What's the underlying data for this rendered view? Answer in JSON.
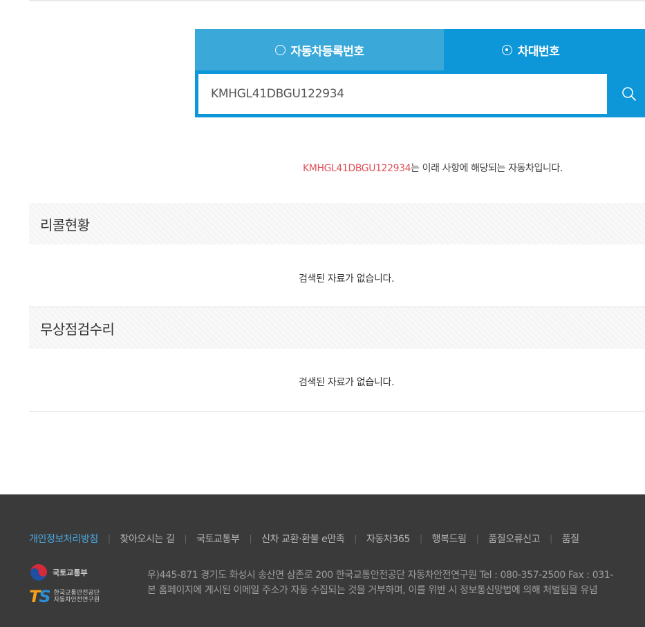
{
  "search": {
    "tab_registration": "자동차등록번호",
    "tab_vin": "차대번호",
    "selected_tab": "vin",
    "input_value": "KMHGL41DBGU122934"
  },
  "result": {
    "vin": "KMHGL41DBGU122934",
    "message_suffix": "는 이래 사항에 해당되는 자동차입니다."
  },
  "sections": {
    "recall": {
      "title": "리콜현황",
      "empty": "검색된 자료가 없습니다."
    },
    "free_repair": {
      "title": "무상점검수리",
      "empty": "검색된 자료가 없습니다."
    }
  },
  "footer": {
    "links": [
      "개인정보처리방침",
      "찾아오시는 길",
      "국토교통부",
      "신차 교환·환불 e만족",
      "자동차365",
      "행복드림",
      "품질오류신고",
      "품질"
    ],
    "logo_molit": "국토교통부",
    "logo_ts_line1": "한국교통안전공단",
    "logo_ts_line2": "자동차안전연구원",
    "address": "우)445-871 경기도 화성시 송산면 삼존로 200 한국교통안전공단 자동차안전연구원 Tel : 080-357-2500 Fax : 031-",
    "notice": "본 홈페이지에 게시된 이메일 주소가 자동 수집되는 것을 거부하며, 이를 위반 시 정보통신망법에 의해 처벌됨을 유념"
  },
  "colors": {
    "accent": "#0d96d8",
    "tab_inactive": "#3aa8d8",
    "vin_highlight": "#e0525a",
    "footer_bg": "#3a3a3a",
    "footer_link_active": "#4aa8e0"
  }
}
